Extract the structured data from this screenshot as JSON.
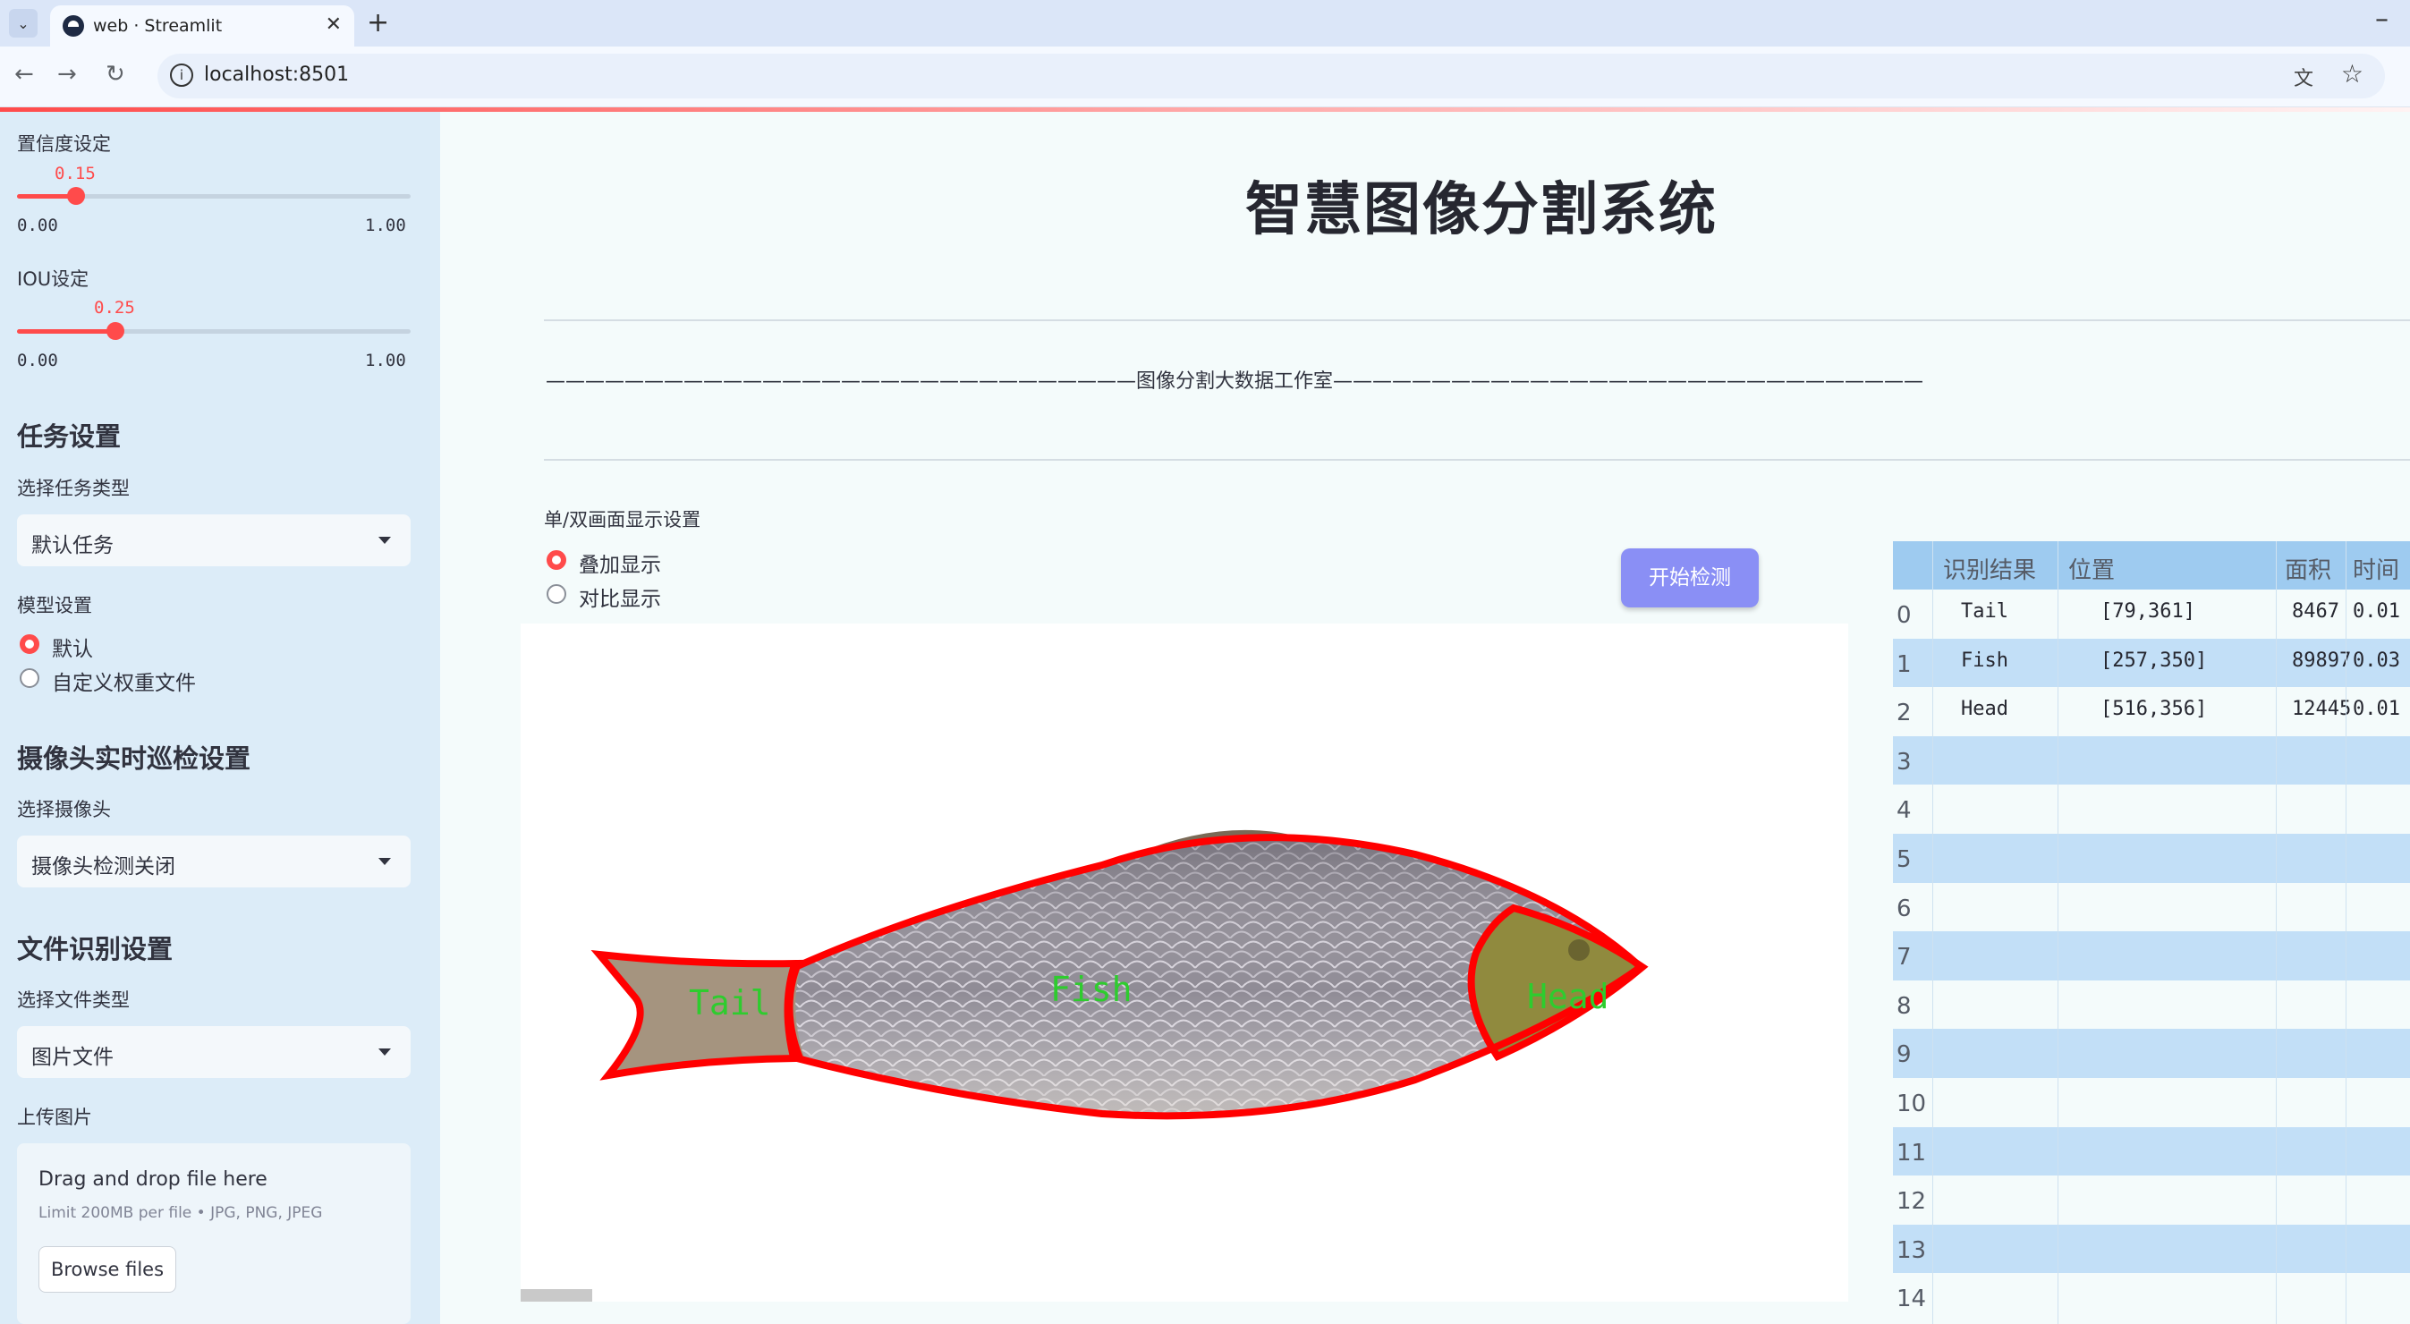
{
  "browser": {
    "tab_title": "web · Streamlit",
    "url": "localhost:8501"
  },
  "sidebar": {
    "confidence": {
      "label": "置信度设定",
      "value": "0.15",
      "min": "0.00",
      "max": "1.00",
      "fraction": 0.15
    },
    "iou": {
      "label": "IOU设定",
      "value": "0.25",
      "min": "0.00",
      "max": "1.00",
      "fraction": 0.25
    },
    "task_heading": "任务设置",
    "task_type_label": "选择任务类型",
    "task_type_value": "默认任务",
    "model_label": "模型设置",
    "model_options": [
      "默认",
      "自定义权重文件"
    ],
    "model_selected": "默认",
    "camera_heading": "摄像头实时巡检设置",
    "camera_label": "选择摄像头",
    "camera_value": "摄像头检测关闭",
    "file_heading": "文件识别设置",
    "file_type_label": "选择文件类型",
    "file_type_value": "图片文件",
    "upload_label": "上传图片",
    "upload_title": "Drag and drop file here",
    "upload_limit": "Limit 200MB per file • JPG, PNG, JPEG",
    "browse_label": "Browse files"
  },
  "main": {
    "title": "智慧图像分割系统",
    "subtitle_line": "——————————————————————————————图像分割大数据工作室——————————————————————————————",
    "display_label": "单/双画面显示设置",
    "display_options": [
      "叠加显示",
      "对比显示"
    ],
    "display_selected": "叠加显示",
    "start_button": "开始检测",
    "image_labels": {
      "tail": "Tail",
      "fish": "Fish",
      "head": "Head"
    }
  },
  "results_table": {
    "headers": [
      "识别结果",
      "位置",
      "面积",
      "时间"
    ],
    "rows": [
      {
        "idx": "0",
        "result": "Tail",
        "position": "[79,361]",
        "area": "8467",
        "time": "0.01"
      },
      {
        "idx": "1",
        "result": "Fish",
        "position": "[257,350]",
        "area": "89897",
        "time": "0.03"
      },
      {
        "idx": "2",
        "result": "Head",
        "position": "[516,356]",
        "area": "12445",
        "time": "0.01"
      },
      {
        "idx": "3",
        "result": "",
        "position": "",
        "area": "",
        "time": ""
      },
      {
        "idx": "4",
        "result": "",
        "position": "",
        "area": "",
        "time": ""
      },
      {
        "idx": "5",
        "result": "",
        "position": "",
        "area": "",
        "time": ""
      },
      {
        "idx": "6",
        "result": "",
        "position": "",
        "area": "",
        "time": ""
      },
      {
        "idx": "7",
        "result": "",
        "position": "",
        "area": "",
        "time": ""
      },
      {
        "idx": "8",
        "result": "",
        "position": "",
        "area": "",
        "time": ""
      },
      {
        "idx": "9",
        "result": "",
        "position": "",
        "area": "",
        "time": ""
      },
      {
        "idx": "10",
        "result": "",
        "position": "",
        "area": "",
        "time": ""
      },
      {
        "idx": "11",
        "result": "",
        "position": "",
        "area": "",
        "time": ""
      },
      {
        "idx": "12",
        "result": "",
        "position": "",
        "area": "",
        "time": ""
      },
      {
        "idx": "13",
        "result": "",
        "position": "",
        "area": "",
        "time": ""
      },
      {
        "idx": "14",
        "result": "",
        "position": "",
        "area": "",
        "time": ""
      }
    ]
  },
  "colors": {
    "accent": "#ff4b4b",
    "button": "#8a8ff5",
    "table_header": "#9ecbf0",
    "table_stripe": "#c2dff7",
    "mask_outline": "#ff0000",
    "mask_label": "#2ecc2e"
  }
}
